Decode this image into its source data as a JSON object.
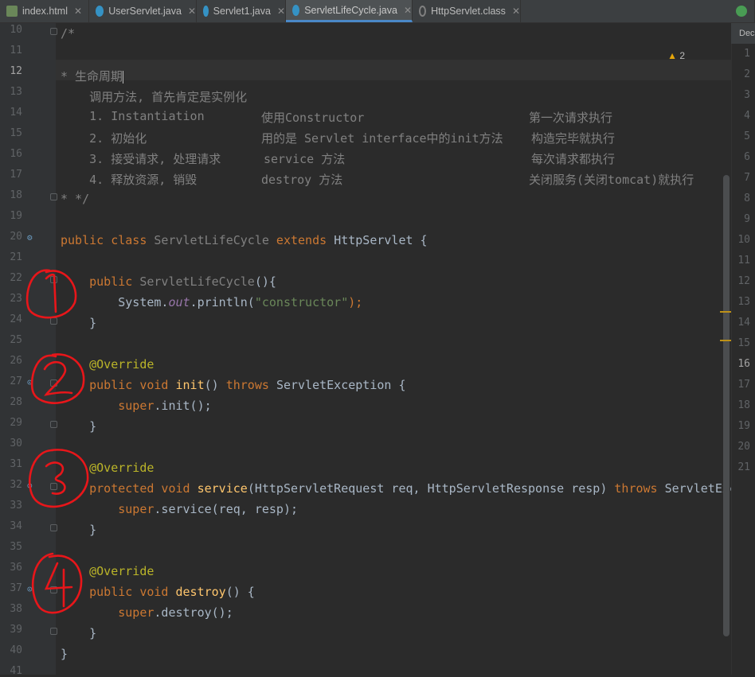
{
  "tabs": [
    {
      "label": "index.html",
      "icon": "html-file-icon"
    },
    {
      "label": "UserServlet.java",
      "icon": "java-class-icon"
    },
    {
      "label": "Servlet1.java",
      "icon": "java-class-icon"
    },
    {
      "label": "ServletLifeCycle.java",
      "icon": "java-class-icon",
      "active": true
    },
    {
      "label": "HttpServlet.class",
      "icon": "class-file-icon"
    }
  ],
  "editor": {
    "warning_count": "2",
    "line_numbers": [
      "10",
      "11",
      "12",
      "13",
      "14",
      "15",
      "16",
      "17",
      "18",
      "19",
      "20",
      "21",
      "22",
      "23",
      "24",
      "25",
      "26",
      "27",
      "28",
      "29",
      "30",
      "31",
      "32",
      "33",
      "34",
      "35",
      "36",
      "37",
      "38",
      "39",
      "40",
      "41"
    ],
    "current_line": "12",
    "code": {
      "l10": "/*",
      "l12": "* 生命周期",
      "l13": "    调用方法, 首先肯定是实例化",
      "l14": [
        "    1. Instantiation",
        "使用Constructor",
        "第一次请求执行"
      ],
      "l15": [
        "    2. 初始化",
        "用的是 Servlet interface中的init方法",
        "构造完毕就执行"
      ],
      "l16": [
        "    3. 接受请求, 处理请求",
        "service 方法",
        "每次请求都执行"
      ],
      "l17": [
        "    4. 释放资源, 销毁",
        "destroy 方法",
        "关闭服务(关闭tomcat)就执行"
      ],
      "l18": "* */",
      "l20": {
        "kw": "public class ",
        "name": "ServletLifeCycle",
        "kw2": " extends ",
        "parent": "HttpServlet {"
      },
      "l22": {
        "kw": "    public ",
        "name": "ServletLifeCycle",
        "rest": "(){"
      },
      "l23": {
        "a": "        System.",
        "field": "out",
        "b": ".println(",
        "str": "\"constructor\"",
        "c": ");"
      },
      "l24": "    }",
      "l26": "    @Override",
      "l27": {
        "kw": "    public void ",
        "mth": "init",
        "a": "() ",
        "kw2": "throws ",
        "b": "ServletException {"
      },
      "l28": {
        "kw": "        super",
        "a": ".init();"
      },
      "l29": "    }",
      "l31": "    @Override",
      "l32": {
        "kw": "    protected void ",
        "mth": "service",
        "a": "(HttpServletRequest req, HttpServletResponse resp) ",
        "kw2": "throws ",
        "b": "ServletExc"
      },
      "l33": {
        "kw": "        super",
        "a": ".service(req, resp);"
      },
      "l34": "    }",
      "l36": "    @Override",
      "l37": {
        "kw": "    public void ",
        "mth": "destroy",
        "a": "() {"
      },
      "l38": {
        "kw": "        super",
        "a": ".destroy();"
      },
      "l39": "    }",
      "l40": "}"
    }
  },
  "right_panel": {
    "header": "Dec",
    "line_numbers": [
      "1",
      "2",
      "3",
      "4",
      "5",
      "6",
      "7",
      "8",
      "9",
      "10",
      "11",
      "12",
      "13",
      "14",
      "15",
      "16",
      "17",
      "18",
      "19",
      "20",
      "21"
    ],
    "current_line": "16"
  },
  "handwritten_annotations": [
    "1",
    "2",
    "3",
    "4"
  ],
  "colors": {
    "background": "#2b2b2b",
    "keyword": "#cc7832",
    "string": "#6a8759",
    "annotation": "#bbb529",
    "method": "#ffc66d",
    "comment": "#808080",
    "ink": "#e8161a"
  }
}
